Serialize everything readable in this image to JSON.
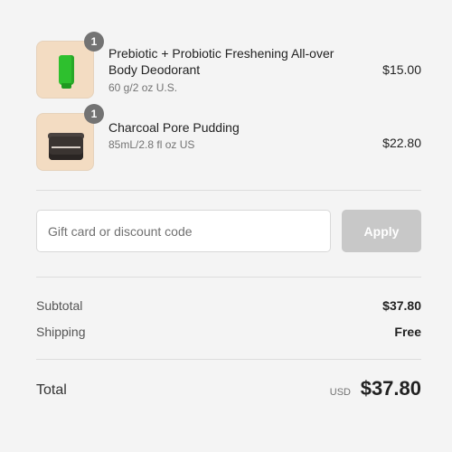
{
  "items": [
    {
      "name": "Prebiotic + Probiotic Freshening All-over Body Deodorant",
      "variant": "60 g/2 oz U.S.",
      "price": "$15.00",
      "quantity": "1",
      "image": "green-tube-product"
    },
    {
      "name": "Charcoal Pore Pudding",
      "variant": "85mL/2.8 fl oz US",
      "price": "$22.80",
      "quantity": "1",
      "image": "charcoal-jar-product"
    }
  ],
  "discount": {
    "placeholder": "Gift card or discount code",
    "value": "",
    "apply_label": "Apply"
  },
  "totals": {
    "subtotal_label": "Subtotal",
    "subtotal_value": "$37.80",
    "shipping_label": "Shipping",
    "shipping_value": "Free",
    "total_label": "Total",
    "total_currency": "USD",
    "total_value": "$37.80"
  },
  "colors": {
    "background": "#f4f4f4",
    "thumbnail_bg": "#f3dcc2",
    "badge": "#737373",
    "apply_disabled": "#c8c8c8",
    "product_green": "#2ec02e",
    "product_charcoal": "#3a3431"
  }
}
